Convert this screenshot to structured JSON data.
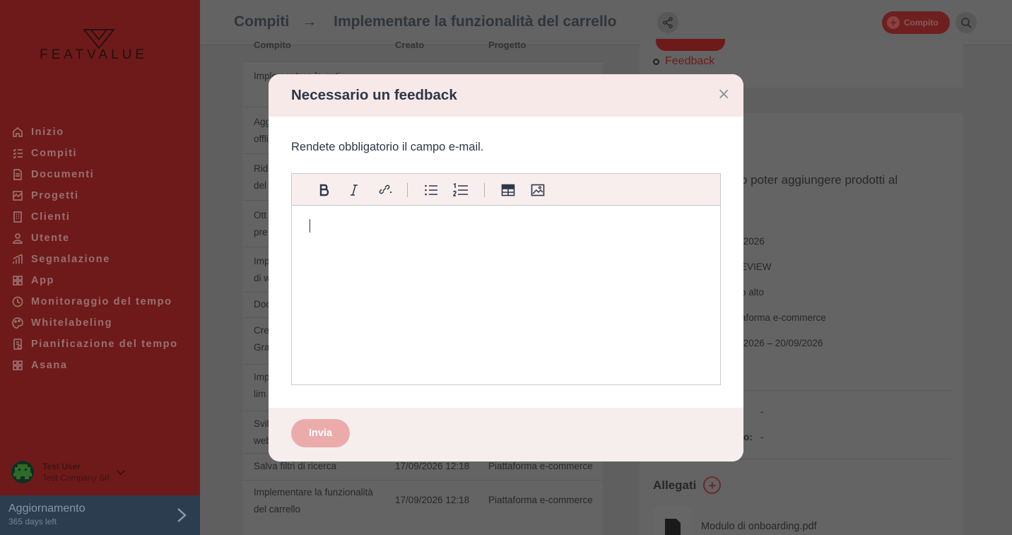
{
  "sidebar": {
    "logo_text": "FEATVALUE",
    "items": [
      {
        "label": "Inizio",
        "icon": "home-icon"
      },
      {
        "label": "Compiti",
        "icon": "tasks-icon"
      },
      {
        "label": "Documenti",
        "icon": "document-icon"
      },
      {
        "label": "Progetti",
        "icon": "projects-icon"
      },
      {
        "label": "Clienti",
        "icon": "clients-icon"
      },
      {
        "label": "Utente",
        "icon": "user-icon"
      },
      {
        "label": "Segnalazione",
        "icon": "report-icon"
      },
      {
        "label": "App",
        "icon": "apps-icon"
      },
      {
        "label": "Monitoraggio del tempo",
        "icon": "time-tracking-icon"
      },
      {
        "label": "Whitelabeling",
        "icon": "whitelabel-icon"
      },
      {
        "label": "Pianificazione del tempo",
        "icon": "time-planning-icon"
      },
      {
        "label": "Asana",
        "icon": "asana-icon"
      }
    ],
    "user": {
      "name": "Test User",
      "company": "Test Company Srl"
    },
    "upgrade": {
      "title": "Aggiornamento",
      "subtitle": "365 days left"
    }
  },
  "header": {
    "crumb_root": "Compiti",
    "crumb_arrow": "→",
    "crumb_current": "Implementare la funzionalità del carrello",
    "new_task_label": "Compito"
  },
  "table": {
    "headers": [
      "Compito",
      "Creato",
      "Progetto"
    ],
    "rows": [
      {
        "task": "Implementare le noti",
        "created": "",
        "project": ""
      },
      {
        "task": "Agg offli",
        "created": "",
        "project": ""
      },
      {
        "task": "Rid del",
        "created": "",
        "project": ""
      },
      {
        "task": "Ott pre",
        "created": "",
        "project": ""
      },
      {
        "task": "Imp di w",
        "created": "",
        "project": ""
      },
      {
        "task": "Doc",
        "created": "",
        "project": ""
      },
      {
        "task": "Cre Gra",
        "created": "",
        "project": ""
      },
      {
        "task": "Imp lim",
        "created": "",
        "project": ""
      },
      {
        "task": "Svil web",
        "created": "",
        "project": ""
      },
      {
        "task": "Salva filtri di ricerca",
        "created": "17/09/2026 12:18",
        "project": "Piattaforma e-commerce"
      },
      {
        "task": "Implementare la funzionalità del carrello",
        "created": "17/09/2026 12:18",
        "project": "Piattaforma e-commerce"
      }
    ]
  },
  "details": {
    "feedback_link": "Feedback",
    "description_fragment": "o poter aggiungere prodotti al",
    "date_fragment": "/2026",
    "status_fragment": "EVIEW",
    "priority_fragment": "o alto",
    "project_fragment": "aforma e-commerce",
    "period_fragment": "/2026 – 20/09/2026",
    "dash1": "-",
    "colon_fragment": "o:",
    "dash2": "-",
    "attachments_title": "Allegati",
    "attachment_name": "Modulo di onboarding.pdf"
  },
  "modal": {
    "title": "Necessario un feedback",
    "close_symbol": "×",
    "description": "Rendete obbligatorio il campo e-mail.",
    "toolbar": [
      "bold-icon",
      "italic-icon",
      "link-icon",
      "bullet-list-icon",
      "numbered-list-icon",
      "table-icon",
      "image-icon"
    ],
    "editor_value": "",
    "submit_label": "Invia"
  },
  "colors": {
    "brand": "#e35050",
    "sidebar": "#6e1a1a",
    "modal_header": "#f7e9e8",
    "submit_disabled": "#ecabab"
  }
}
